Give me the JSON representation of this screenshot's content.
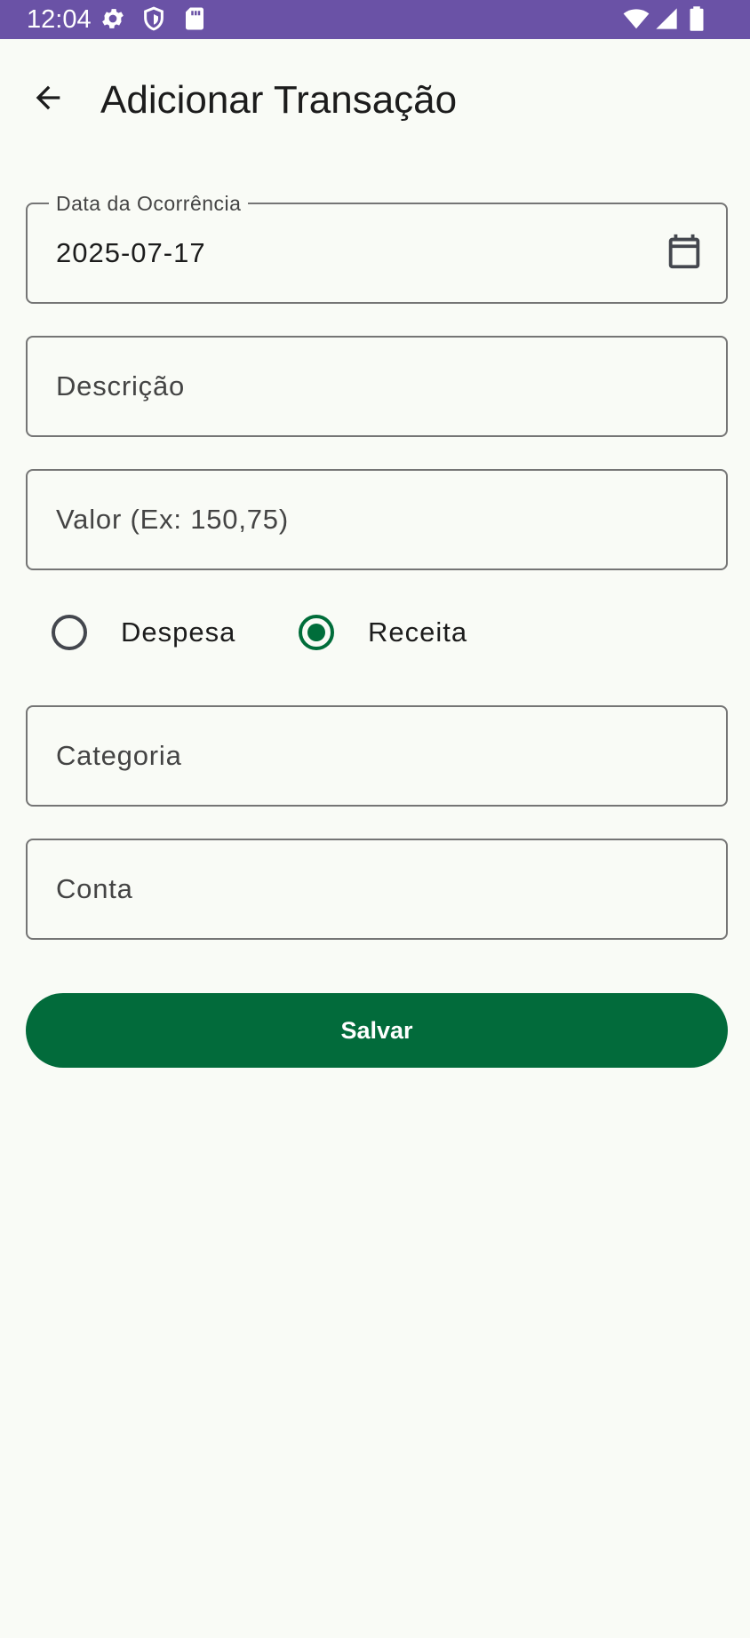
{
  "status_bar": {
    "time": "12:04",
    "icons": [
      "gear-icon",
      "shield-icon",
      "sd-card-icon",
      "wifi-icon",
      "cellular-signal-icon",
      "battery-icon"
    ]
  },
  "app_bar": {
    "back_icon": "arrow-back-icon",
    "title": "Adicionar Transação"
  },
  "form": {
    "date": {
      "label": "Data da Ocorrência",
      "value": "2025-07-17",
      "icon": "calendar-icon"
    },
    "description": {
      "placeholder": "Descrição",
      "value": ""
    },
    "amount": {
      "placeholder": "Valor (Ex: 150,75)",
      "value": ""
    },
    "type": {
      "options": [
        {
          "label": "Despesa",
          "selected": false
        },
        {
          "label": "Receita",
          "selected": true
        }
      ]
    },
    "category": {
      "placeholder": "Categoria",
      "value": ""
    },
    "account": {
      "placeholder": "Conta",
      "value": ""
    },
    "save_label": "Salvar"
  },
  "colors": {
    "status_bar": "#6a52a6",
    "background": "#f9fbf6",
    "primary": "#026b3b",
    "outline": "#757575"
  }
}
